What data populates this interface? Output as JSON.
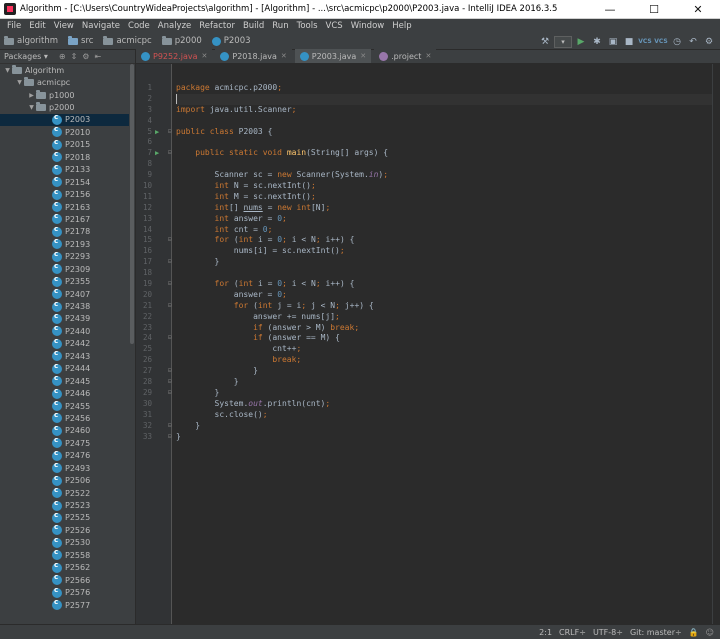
{
  "window": {
    "title": "Algorithm - [C:\\Users\\CountryWideaProjects\\algorithm] - [Algorithm] - ...\\src\\acmicpc\\p2000\\P2003.java - IntelliJ IDEA 2016.3.5",
    "minimize": "—",
    "maximize": "☐",
    "close": "✕"
  },
  "menu": [
    "File",
    "Edit",
    "View",
    "Navigate",
    "Code",
    "Analyze",
    "Refactor",
    "Build",
    "Run",
    "Tools",
    "VCS",
    "Window",
    "Help"
  ],
  "breadcrumbs": [
    "algorithm",
    "src",
    "acmicpc",
    "p2000",
    "P2003"
  ],
  "toolbar_icons": [
    "run-icon",
    "debug-icon",
    "coverage-icon",
    "stop-icon",
    "vcs-update-icon",
    "vcs-commit-icon",
    "history-icon",
    "revert-icon",
    "settings-icon"
  ],
  "toolbar_labels": {
    "vcs": "VCS"
  },
  "project_panel": {
    "view_label": "Packages",
    "root": "Algorithm",
    "package": "acmicpc",
    "folders": [
      "p1000",
      "p2000"
    ],
    "selected": "P2003",
    "files": [
      "P2003",
      "P2010",
      "P2015",
      "P2018",
      "P2133",
      "P2154",
      "P2156",
      "P2163",
      "P2167",
      "P2178",
      "P2193",
      "P2293",
      "P2309",
      "P2355",
      "P2407",
      "P2438",
      "P2439",
      "P2440",
      "P2442",
      "P2443",
      "P2444",
      "P2445",
      "P2446",
      "P2455",
      "P2456",
      "P2460",
      "P2475",
      "P2476",
      "P2493",
      "P2506",
      "P2522",
      "P2523",
      "P2525",
      "P2526",
      "P2530",
      "P2558",
      "P2562",
      "P2566",
      "P2576",
      "P2577"
    ]
  },
  "tabs": [
    {
      "label": "P9252.java",
      "state": "error"
    },
    {
      "label": "P2018.java",
      "state": "normal"
    },
    {
      "label": "P2003.java",
      "state": "active"
    },
    {
      "label": ".project",
      "state": "normal"
    }
  ],
  "code_lines": [
    "package acmicpc.p2000;",
    "",
    "import java.util.Scanner;",
    "",
    "public class P2003 {",
    "",
    "    public static void main(String[] args) {",
    "",
    "        Scanner sc = new Scanner(System.in);",
    "        int N = sc.nextInt();",
    "        int M = sc.nextInt();",
    "        int[] nums = new int[N];",
    "        int answer = 0;",
    "        int cnt = 0;",
    "        for (int i = 0; i < N; i++) {",
    "            nums[i] = sc.nextInt();",
    "        }",
    "",
    "        for (int i = 0; i < N; i++) {",
    "            answer = 0;",
    "            for (int j = i; j < N; j++) {",
    "                answer += nums[j];",
    "                if (answer > M) break;",
    "                if (answer == M) {",
    "                    cnt++;",
    "                    break;",
    "                }",
    "            }",
    "        }",
    "        System.out.println(cnt);",
    "        sc.close();",
    "    }",
    "}"
  ],
  "status": {
    "position": "2:1",
    "line_sep": "CRLF÷",
    "encoding": "UTF-8÷",
    "git": "Git: master÷"
  }
}
